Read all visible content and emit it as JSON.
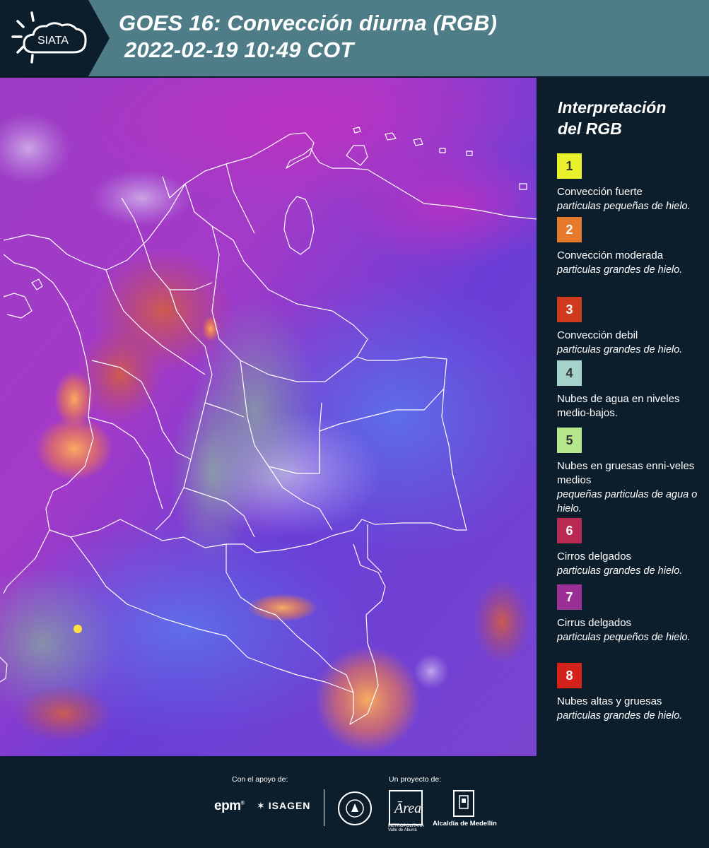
{
  "header": {
    "logo_text": "SIATA",
    "title_line1": "GOES 16: Convección diurna (RGB)",
    "title_line2": "2022-02-19 10:49 COT"
  },
  "legend": {
    "title_line1": "Interpretación",
    "title_line2": "del RGB",
    "items": [
      {
        "number": "1",
        "color": "#e8f02a",
        "name": "Convección fuerte",
        "desc": "particulas pequeñas de hielo."
      },
      {
        "number": "2",
        "color": "#e57a2a",
        "name": "Convección moderada",
        "desc": "particulas grandes de hielo."
      },
      {
        "number": "3",
        "color": "#cf3a1f",
        "name": "Convección debil",
        "desc": "particulas grandes de hielo."
      },
      {
        "number": "4",
        "color": "#a6d2cc",
        "name": "Nubes de agua en niveles medio-bajos.",
        "desc": ""
      },
      {
        "number": "5",
        "color": "#b4e88a",
        "name": "Nubes en gruesas enni-veles medios",
        "desc": "pequeñas particulas de agua o hielo."
      },
      {
        "number": "6",
        "color": "#b82a52",
        "name": "Cirros delgados",
        "desc": "particulas grandes de hielo."
      },
      {
        "number": "7",
        "color": "#9a2f95",
        "name": "Cirrus delgados",
        "desc": "particulas pequeños de hielo."
      },
      {
        "number": "8",
        "color": "#d4221b",
        "name": "Nubes altas y gruesas",
        "desc": "particulas grandes de hielo."
      }
    ]
  },
  "footer": {
    "support_label": "Con el apoyo de:",
    "project_label": "Un proyecto de:",
    "sponsor1": "epm",
    "sponsor2": "ISAGEN",
    "partner_area": "METROPOLITANA Valle de Aburrá",
    "partner_alcaldia": "Alcaldía de Medellín"
  },
  "colors": {
    "header_bg": "#4e7c87",
    "panel_bg": "#0c1e2b"
  }
}
